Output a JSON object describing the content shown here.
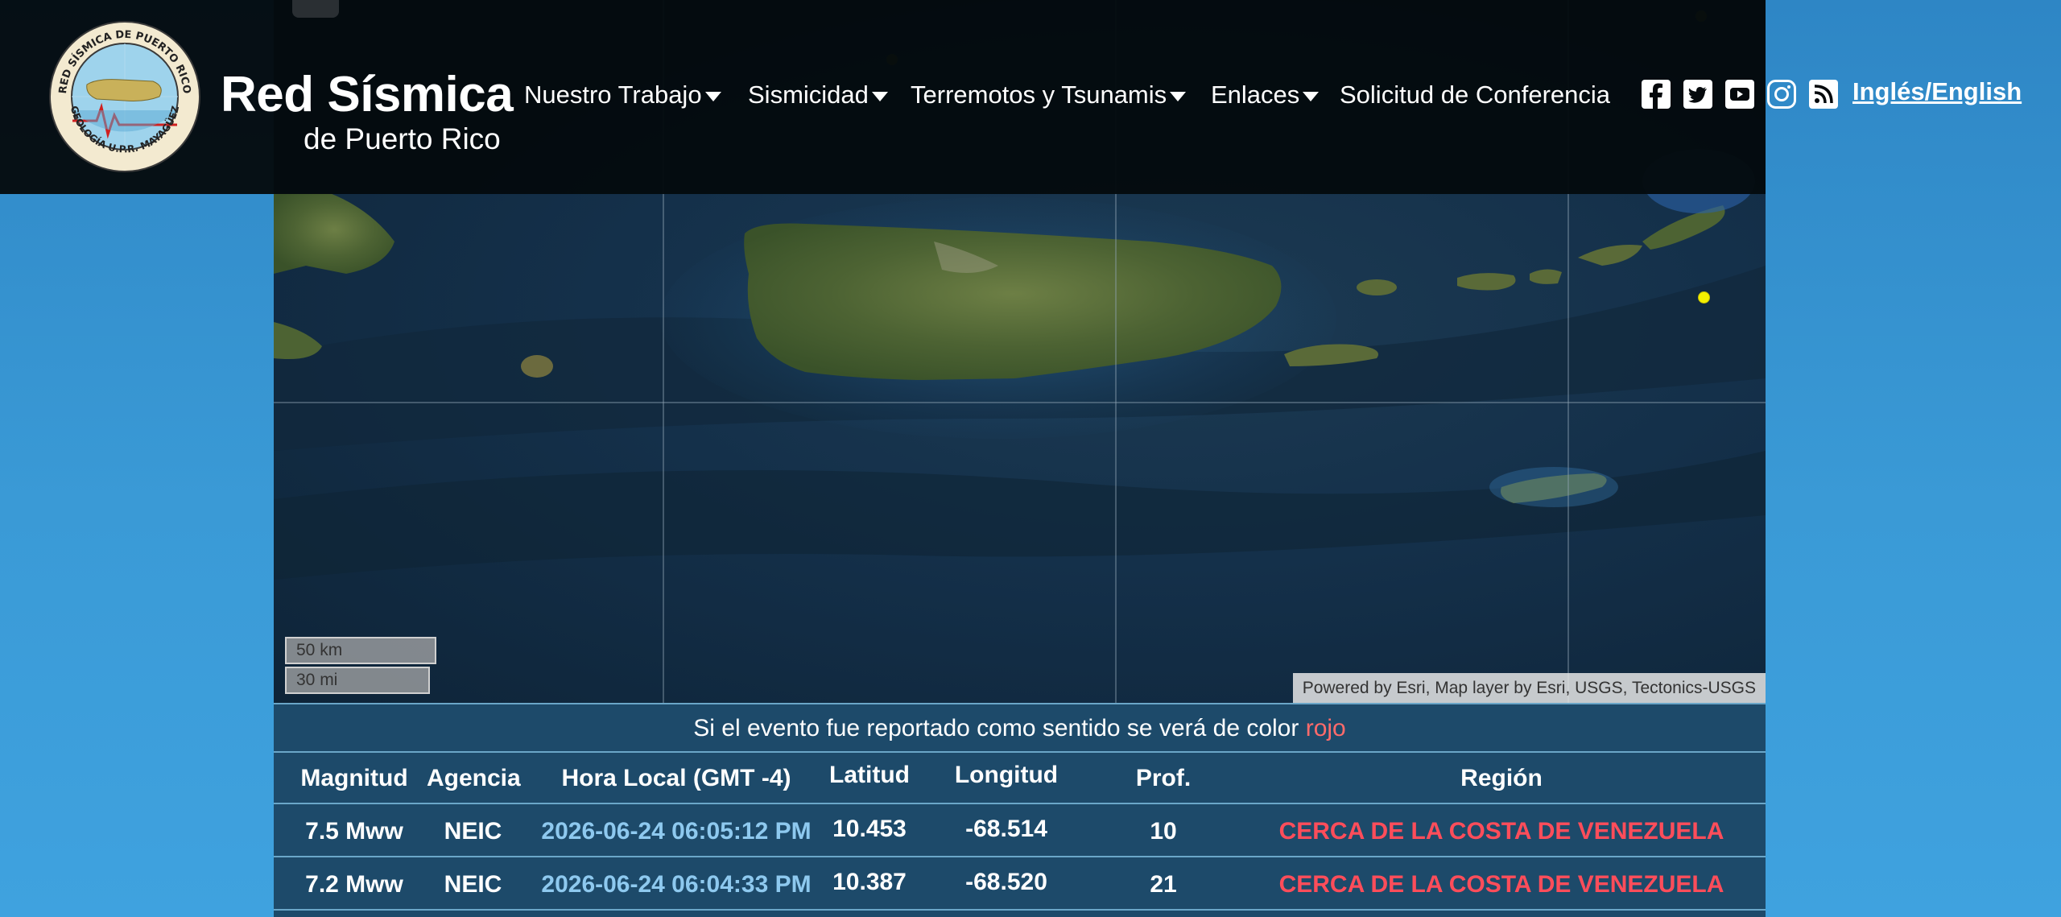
{
  "header": {
    "logo_ring_text_top": "RED SÍSMICA DE PUERTO RICO",
    "logo_ring_text_bottom": "GEOLOGÍA U.P.R. MAYAGÜEZ",
    "title": "Red Sísmica",
    "subtitle": "de Puerto Rico",
    "nav": [
      {
        "label": "Nuestro Trabajo",
        "dropdown": true
      },
      {
        "label": "Sismicidad",
        "dropdown": true
      },
      {
        "label": "Terremotos y Tsunamis",
        "dropdown": true
      },
      {
        "label": "Enlaces",
        "dropdown": true
      },
      {
        "label": "Solicitud de Conferencia",
        "dropdown": false
      }
    ],
    "social_icons": [
      "facebook-icon",
      "twitter-icon",
      "youtube-icon",
      "instagram-icon",
      "rss-icon"
    ],
    "language_link": "Inglés/English"
  },
  "map": {
    "scale_km": "50 km",
    "scale_mi": "30 mi",
    "attribution": "Powered by Esri, Map layer by Esri, USGS, Tectonics-USGS"
  },
  "events": {
    "felt_note_prefix": "Si el evento fue reportado como sentido se verá de color ",
    "felt_note_highlight": "rojo",
    "columns": [
      "Magnitud",
      "Agencia",
      "Hora Local (GMT -4)",
      "Latitud",
      "Longitud",
      "Prof.",
      "Región"
    ],
    "rows": [
      [
        "7.5 Mww",
        "NEIC",
        "2026-06-24 06:05:12 PM",
        "10.453",
        "-68.514",
        "10",
        "CERCA DE LA COSTA DE VENEZUELA"
      ],
      [
        "7.2 Mww",
        "NEIC",
        "2026-06-24 06:04:33 PM",
        "10.387",
        "-68.520",
        "21",
        "CERCA DE LA COSTA DE VENEZUELA"
      ]
    ]
  },
  "colors": {
    "header_bg": "#05090c",
    "panel_bg": "#1d4a6a",
    "felt_red": "#ff4d5a",
    "time_blue": "#8ec9ef",
    "quake_marker": "#f5f000"
  }
}
